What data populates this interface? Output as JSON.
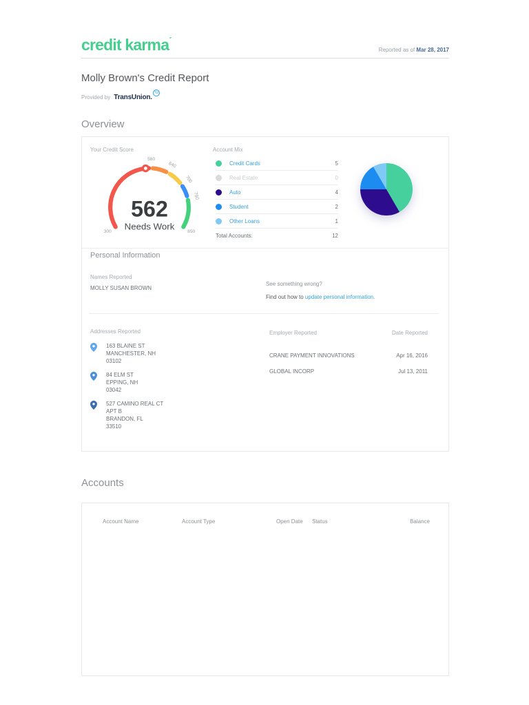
{
  "header": {
    "logo_text": "credit karma",
    "reported_prefix": "Reported as of ",
    "reported_date": "Mar 28, 2017"
  },
  "title": {
    "page_title": "Molly Brown's Credit Report",
    "provided_by": "Provided by",
    "bureau": "TransUnion.",
    "bureau_badge": "TU"
  },
  "overview": {
    "heading": "Overview",
    "score_label": "Your Credit Score",
    "account_mix": {
      "label": "Account Mix",
      "items": [
        {
          "label": "Credit Cards",
          "count": "5",
          "color": "#45d09e",
          "active": true
        },
        {
          "label": "Real Estate",
          "count": "0",
          "color": "#d8dadc",
          "active": false
        },
        {
          "label": "Auto",
          "count": "4",
          "color": "#2d0c8e",
          "active": true
        },
        {
          "label": "Student",
          "count": "2",
          "color": "#1d8cf0",
          "active": true
        },
        {
          "label": "Other Loans",
          "count": "1",
          "color": "#7fc9f7",
          "active": true
        }
      ],
      "total_label": "Total Accounts:",
      "total": "12"
    }
  },
  "personal": {
    "heading": "Personal Information",
    "names_label": "Names Reported",
    "name": "MOLLY SUSAN BROWN",
    "wrong_text": "See something wrong?",
    "howto_prefix": "Find out how to ",
    "howto_link": "update personal information.",
    "addresses_label": "Addresses Reported",
    "addresses": [
      {
        "lines": [
          "163 BLAINE ST",
          "MANCHESTER, NH",
          "03102"
        ]
      },
      {
        "lines": [
          "84 ELM ST",
          "EPPING, NH",
          "03042"
        ]
      },
      {
        "lines": [
          "527 CAMINO REAL CT",
          "APT B",
          "BRANDON, FL",
          "33510"
        ]
      }
    ],
    "employers_label": "Employer Reported",
    "date_label": "Date Reported",
    "employers": [
      {
        "name": "CRANE PAYMENT INNOVATIONS",
        "date": "Apr 16, 2016"
      },
      {
        "name": "GLOBAL INCORP",
        "date": "Jul 13, 2011"
      }
    ]
  },
  "accounts": {
    "heading": "Accounts",
    "columns": [
      "Account Name",
      "Account Type",
      "Open Date",
      "Status",
      "Balance"
    ]
  },
  "chart_data": [
    {
      "type": "gauge",
      "title": "Your Credit Score",
      "value": 562,
      "value_label": "Needs Work",
      "min": 300,
      "max": 850,
      "tick_labels": [
        300,
        580,
        640,
        700,
        750,
        850
      ],
      "segments": [
        {
          "from": 300,
          "to": 580,
          "color": "#f3564a"
        },
        {
          "from": 580,
          "to": 640,
          "color": "#f79046"
        },
        {
          "from": 640,
          "to": 700,
          "color": "#f9ca49"
        },
        {
          "from": 700,
          "to": 750,
          "color": "#3b8df8"
        },
        {
          "from": 750,
          "to": 850,
          "color": "#43d17c"
        }
      ],
      "needle_color": "#f3564a"
    },
    {
      "type": "pie",
      "title": "Account Mix",
      "labels": [
        "Credit Cards",
        "Auto",
        "Student",
        "Other Loans"
      ],
      "values": [
        5,
        4,
        2,
        1
      ],
      "colors": [
        "#45d09e",
        "#2d0c8e",
        "#1d8cf0",
        "#7fc9f7"
      ],
      "start_angle_deg": 0,
      "direction": "clockwise"
    }
  ]
}
